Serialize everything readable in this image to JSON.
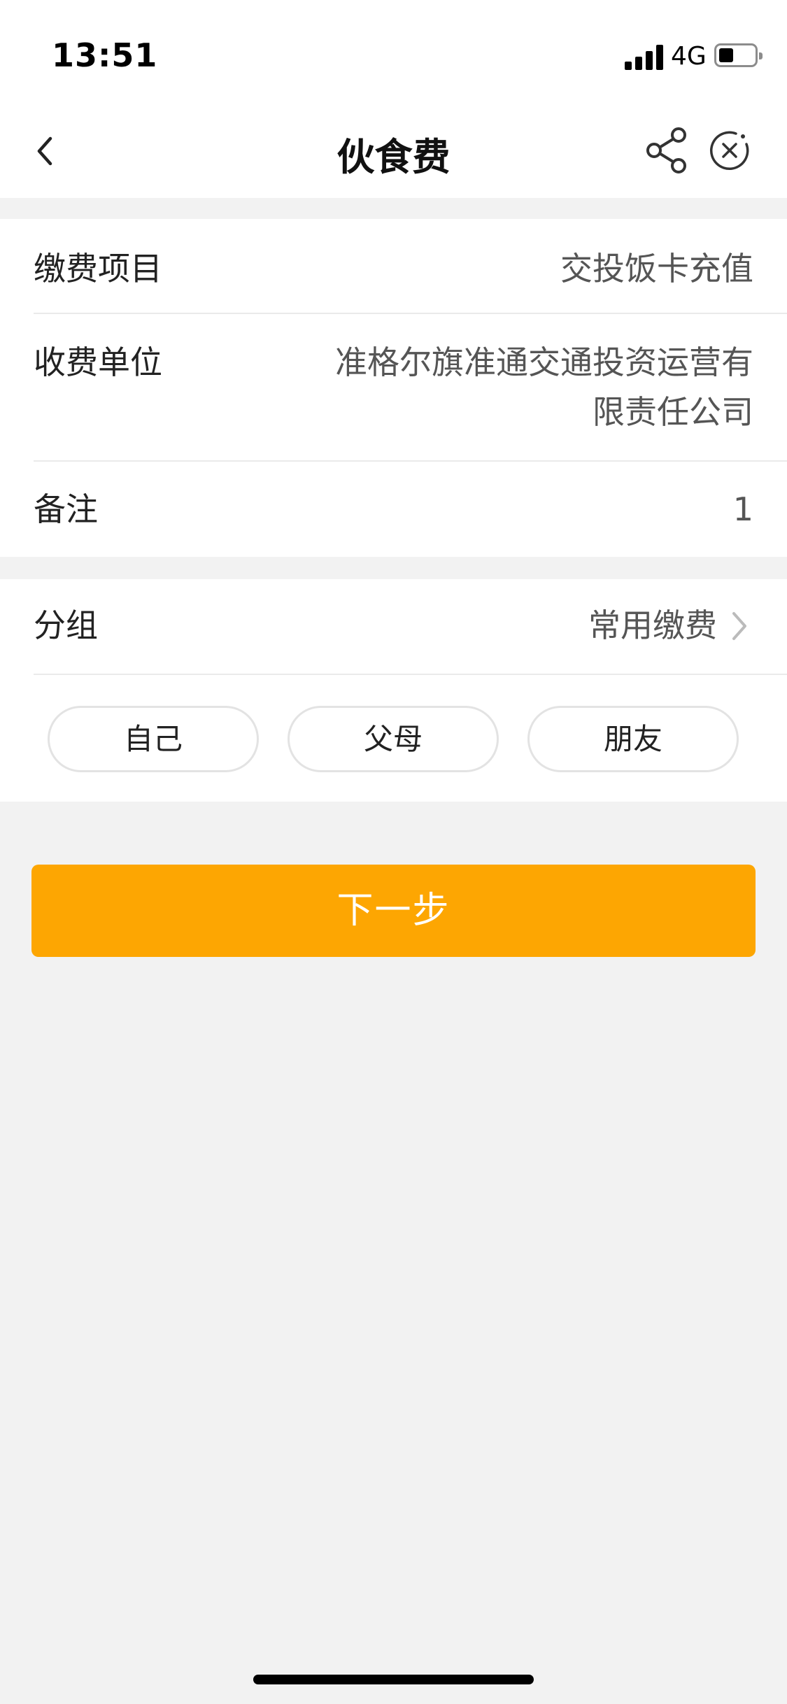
{
  "status_bar": {
    "time": "13:51",
    "network": "4G",
    "battery_percent": 30
  },
  "nav": {
    "title": "伙食费",
    "back_icon": "chevron-left-icon",
    "share_icon": "share-icon",
    "close_icon": "close-circle-icon"
  },
  "details": [
    {
      "label": "缴费项目",
      "value": "交投饭卡充值"
    },
    {
      "label": "收费单位",
      "value_line1": "准格尔旗准通交通投资运营有",
      "value_line2": "限责任公司"
    },
    {
      "label": "备注",
      "value": "1"
    }
  ],
  "group": {
    "label": "分组",
    "value": "常用缴费",
    "options": [
      "自己",
      "父母",
      "朋友"
    ]
  },
  "next_button": {
    "label": "下一步"
  },
  "colors": {
    "accent": "#fda602",
    "background": "#f2f2f2"
  }
}
